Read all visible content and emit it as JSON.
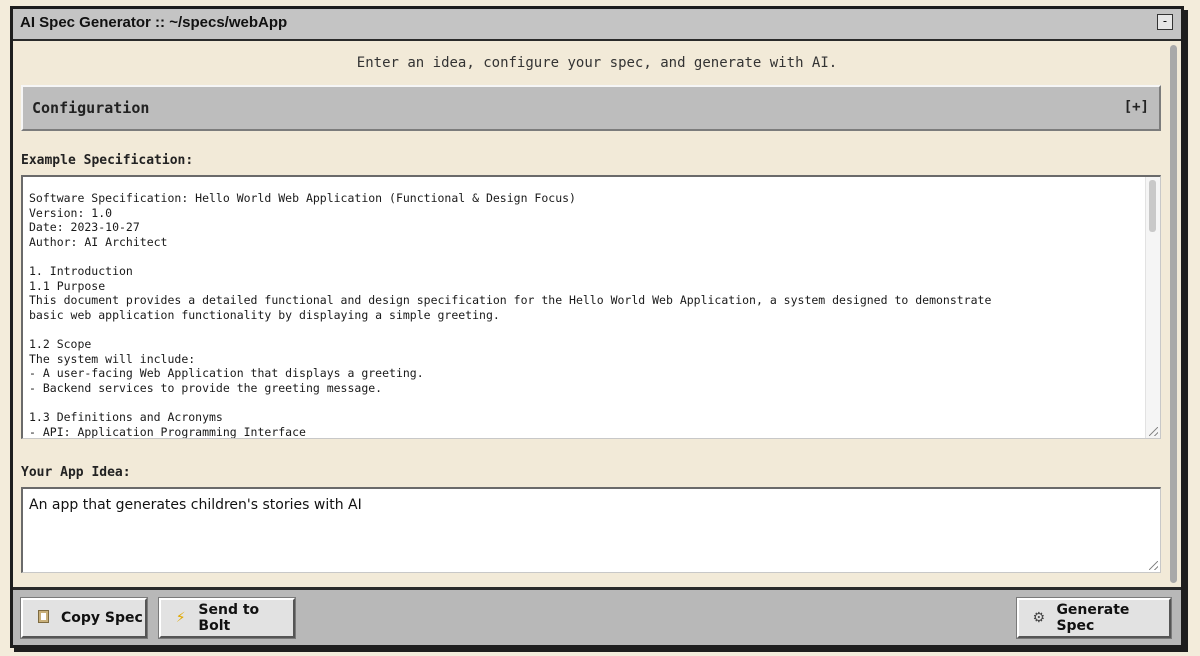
{
  "window": {
    "title": "AI Spec Generator :: ~/specs/webApp",
    "minimize_label": "-"
  },
  "tagline": "Enter an idea, configure your spec, and generate with AI.",
  "config": {
    "title": "Configuration",
    "toggle": "[+]"
  },
  "example_spec": {
    "label": "Example Specification:",
    "text": "Software Specification: Hello World Web Application (Functional & Design Focus)\nVersion: 1.0\nDate: 2023-10-27\nAuthor: AI Architect\n\n1. Introduction\n1.1 Purpose\nThis document provides a detailed functional and design specification for the Hello World Web Application, a system designed to demonstrate\nbasic web application functionality by displaying a simple greeting.\n\n1.2 Scope\nThe system will include:\n- A user-facing Web Application that displays a greeting.\n- Backend services to provide the greeting message.\n\n1.3 Definitions and Acronyms\n- API: Application Programming Interface"
  },
  "app_idea": {
    "label": "Your App Idea:",
    "value": "An app that generates children's stories with AI"
  },
  "buttons": {
    "copy_spec": "Copy Spec",
    "send_to_bolt": "Send to Bolt",
    "generate_spec": "Generate Spec"
  },
  "icons": {
    "copy": "clipboard-icon",
    "send": "lightning-bolt-icon",
    "generate": "gear-icon"
  }
}
